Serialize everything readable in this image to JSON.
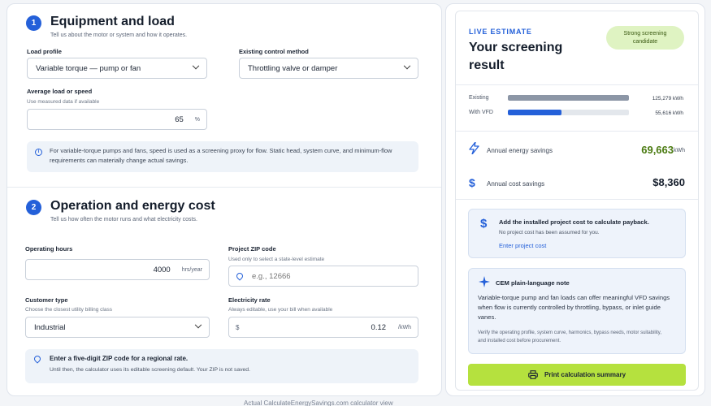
{
  "section1": {
    "step": "1",
    "title": "Equipment and load",
    "subtitle": "Tell us about the motor or system and how it operates.",
    "load_profile_label": "Load profile",
    "load_profile_value": "Variable torque — pump or fan",
    "control_method_label": "Existing control method",
    "control_method_value": "Throttling valve or damper",
    "avg_load_label": "Average load or speed",
    "avg_load_hint": "Use measured data if available",
    "avg_load_value": "65",
    "avg_load_unit": "%",
    "info_text": "For variable-torque pumps and fans, speed is used as a screening proxy for flow. Static head, system curve, and minimum-flow requirements can materially change actual savings."
  },
  "section2": {
    "step": "2",
    "title": "Operation and energy cost",
    "subtitle": "Tell us how often the motor runs and what electricity costs.",
    "hours_label": "Operating hours",
    "hours_value": "4000",
    "hours_unit": "hrs/year",
    "zip_label": "Project ZIP code",
    "zip_hint": "Used only to select a state-level estimate",
    "zip_placeholder": "e.g., 12666",
    "customer_label": "Customer type",
    "customer_hint": "Choose the closest utility billing class",
    "customer_value": "Industrial",
    "rate_label": "Electricity rate",
    "rate_hint": "Always editable, use your bill when available",
    "rate_prefix": "$",
    "rate_value": "0.12",
    "rate_unit": "/kWh",
    "zip_box_title": "Enter a five-digit ZIP code for a regional rate.",
    "zip_box_text": "Until then, the calculator uses its editable screening default. Your ZIP is not saved."
  },
  "result": {
    "live_label": "LIVE ESTIMATE",
    "title": "Your screening result",
    "badge": "Strong screening candidate",
    "bars": [
      {
        "label": "Existing",
        "value": "125,279 kWh",
        "fraction": 1.0,
        "color": "#8c96a6"
      },
      {
        "label": "With VFD",
        "value": "55,616 kWh",
        "fraction": 0.444,
        "color": "#2460d9"
      }
    ],
    "energy_label": "Annual energy savings",
    "energy_value": "69,663",
    "energy_unit": "kWh",
    "cost_label": "Annual cost savings",
    "cost_value": "$8,360",
    "payback_title": "Add the installed project cost to calculate payback.",
    "payback_text": "No project cost has been assumed for you.",
    "payback_link": "Enter project cost",
    "note_title": "CEM plain-language note",
    "note_body": "Variable-torque pump and fan loads can offer meaningful VFD savings when flow is currently controlled by throttling, bypass, or inlet guide vanes.",
    "note_small": "Verify the operating profile, system curve, harmonics, bypass needs, motor suitability, and installed cost before procurement.",
    "print_label": "Print calculation summary"
  },
  "footer": "Actual CalculateEnergySavings.com calculator view"
}
